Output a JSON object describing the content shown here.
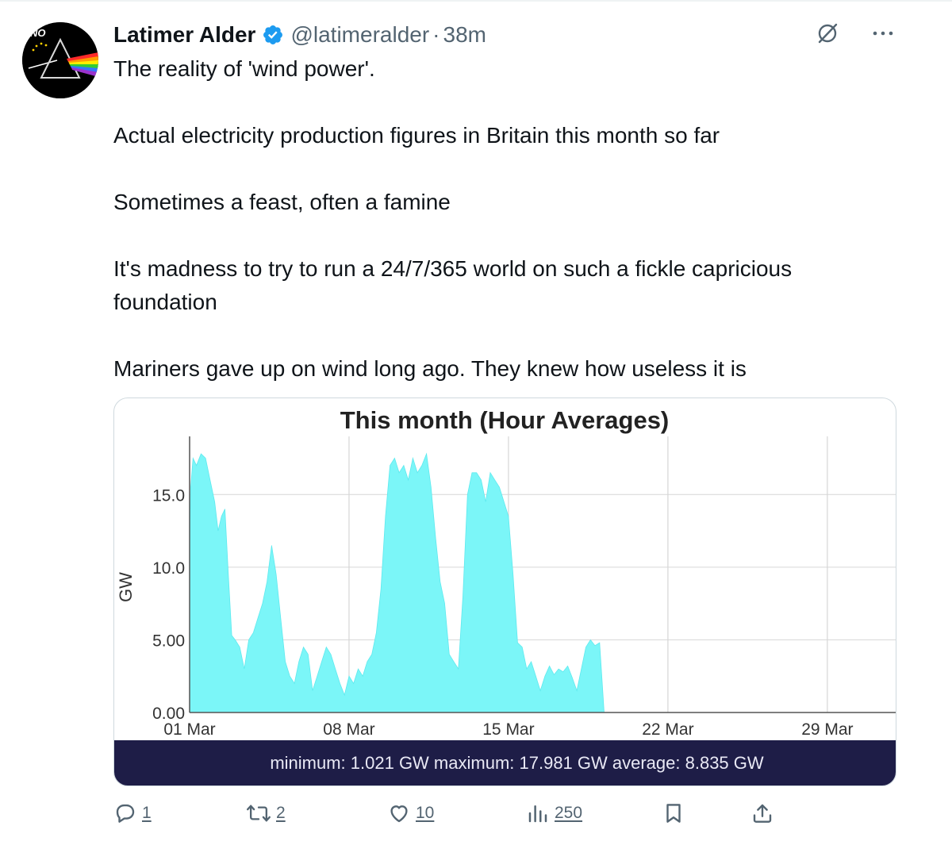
{
  "tweet": {
    "author_name": "Latimer Alder",
    "handle": "@latimeralder",
    "separator": "·",
    "time": "38m",
    "avatar_badge": "NO",
    "paragraphs": [
      "The reality of 'wind power'.",
      "Actual electricity production figures in Britain this month so far",
      "Sometimes a feast, often a famine",
      "It's madness to try to run a 24/7/365 world on such a fickle capricious foundation",
      "Mariners gave up on wind long ago. They knew how useless it is"
    ]
  },
  "icons": {
    "verified": "verified-badge-icon",
    "grok": "grok-icon",
    "more": "more-icon",
    "reply": "reply-icon",
    "retweet": "retweet-icon",
    "like": "like-icon",
    "views": "views-icon",
    "bookmark": "bookmark-icon",
    "share": "share-icon"
  },
  "actions": {
    "replies": "1",
    "retweets": "2",
    "likes": "10",
    "views": "250"
  },
  "colors": {
    "verified": "#1d9bf0",
    "text": "#0f1419",
    "muted": "#536471",
    "area_fill": "#7bf6f8",
    "stats_bar": "#1e1d47"
  },
  "chart_data": {
    "type": "area",
    "title": "This month (Hour Averages)",
    "ylabel": "GW",
    "xlabel": "",
    "xlim": [
      0,
      31
    ],
    "ylim": [
      0,
      19
    ],
    "x_axis_unit": "days since 01 Mar",
    "x_ticks": [
      {
        "label": "01 Mar",
        "value": 0
      },
      {
        "label": "08 Mar",
        "value": 7
      },
      {
        "label": "15 Mar",
        "value": 14
      },
      {
        "label": "22 Mar",
        "value": 21
      },
      {
        "label": "29 Mar",
        "value": 28
      }
    ],
    "y_ticks": [
      {
        "label": "0.00",
        "value": 0
      },
      {
        "label": "5.00",
        "value": 5
      },
      {
        "label": "10.0",
        "value": 10
      },
      {
        "label": "15.0",
        "value": 15
      }
    ],
    "grid": true,
    "series": [
      {
        "name": "GW",
        "x": [
          0,
          0.05,
          0.15,
          0.3,
          0.5,
          0.7,
          0.9,
          1.1,
          1.25,
          1.4,
          1.55,
          1.7,
          1.85,
          2.0,
          2.2,
          2.4,
          2.6,
          2.8,
          3.0,
          3.2,
          3.4,
          3.6,
          3.8,
          4.0,
          4.2,
          4.4,
          4.6,
          4.8,
          5.0,
          5.2,
          5.4,
          5.6,
          5.8,
          6.0,
          6.2,
          6.4,
          6.6,
          6.8,
          7.0,
          7.2,
          7.4,
          7.6,
          7.8,
          8.0,
          8.2,
          8.4,
          8.6,
          8.8,
          9.0,
          9.2,
          9.4,
          9.6,
          9.8,
          10.0,
          10.2,
          10.4,
          10.6,
          10.8,
          11.0,
          11.2,
          11.4,
          11.6,
          11.8,
          12.0,
          12.2,
          12.4,
          12.6,
          12.8,
          13.0,
          13.2,
          13.4,
          13.6,
          13.8,
          14.0,
          14.2,
          14.4,
          14.6,
          14.8,
          15.0,
          15.2,
          15.4,
          15.6,
          15.8,
          16.0,
          16.2,
          16.4,
          16.6,
          16.8,
          17.0,
          17.2,
          17.4,
          17.6,
          17.8,
          18.0,
          18.2,
          18.4,
          18.6,
          18.8,
          19.0,
          19.2,
          19.4,
          19.6,
          19.8,
          20.0,
          20.2,
          20.4,
          20.6,
          20.8,
          21.0,
          21.2,
          21.4,
          21.5
        ],
        "values": [
          11.5,
          15.5,
          17.5,
          17.0,
          17.8,
          17.5,
          16.0,
          14.5,
          12.5,
          13.5,
          14.0,
          9.5,
          5.3,
          5.0,
          4.5,
          3.0,
          5.0,
          5.5,
          6.5,
          7.5,
          9.0,
          11.5,
          9.5,
          6.5,
          3.5,
          2.5,
          2.0,
          3.5,
          4.5,
          4.0,
          1.5,
          2.5,
          3.5,
          4.5,
          4.0,
          3.0,
          2.0,
          1.2,
          2.5,
          2.0,
          3.0,
          2.5,
          3.5,
          4.0,
          5.5,
          8.5,
          13.5,
          17.0,
          17.5,
          16.5,
          17.0,
          16.0,
          17.5,
          16.5,
          17.0,
          17.8,
          15.5,
          12.0,
          9.0,
          7.5,
          4.0,
          3.5,
          3.0,
          8.0,
          15.0,
          16.5,
          16.5,
          16.0,
          14.5,
          16.5,
          16.0,
          15.5,
          14.5,
          13.5,
          9.5,
          4.8,
          4.5,
          3.0,
          3.5,
          2.5,
          1.5,
          2.5,
          3.2,
          2.6,
          3.0,
          2.8,
          3.2,
          2.4,
          1.5,
          3.0,
          4.5,
          5.0,
          4.6,
          4.8,
          0,
          0,
          0,
          0,
          0,
          0,
          0,
          0,
          0,
          0,
          0,
          0,
          0,
          0,
          0,
          0,
          0,
          0
        ]
      }
    ],
    "summary": "minimum: 1.021 GW maximum: 17.981 GW average: 8.835 GW"
  }
}
